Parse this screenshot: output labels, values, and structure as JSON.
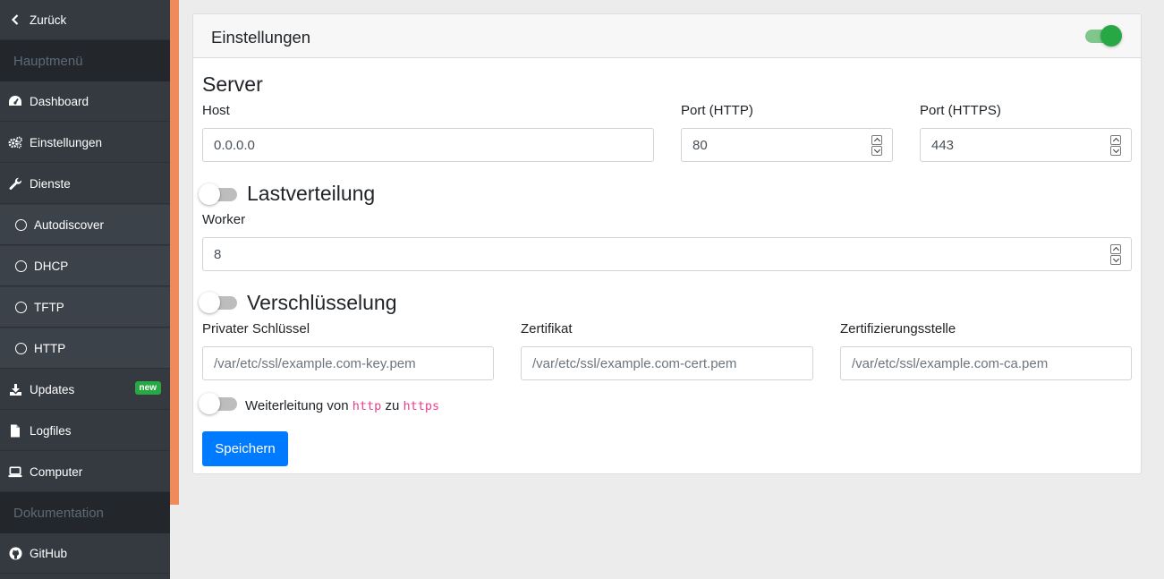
{
  "sidebar": {
    "back_label": "Zurück",
    "main_header": "Hauptmenü",
    "items": [
      {
        "label": "Dashboard",
        "icon": "dashboard-icon"
      },
      {
        "label": "Einstellungen",
        "icon": "gears-icon"
      },
      {
        "label": "Dienste",
        "icon": "wrench-icon"
      }
    ],
    "subitems": [
      {
        "label": "Autodiscover",
        "icon": "circle-icon"
      },
      {
        "label": "DHCP",
        "icon": "circle-icon"
      },
      {
        "label": "TFTP",
        "icon": "circle-icon"
      },
      {
        "label": "HTTP",
        "icon": "circle-icon"
      }
    ],
    "items2": [
      {
        "label": "Updates",
        "icon": "download-icon",
        "badge": "new"
      },
      {
        "label": "Logfiles",
        "icon": "file-icon"
      },
      {
        "label": "Computer",
        "icon": "laptop-icon"
      }
    ],
    "docs_header": "Dokumentation",
    "github_label": "GitHub"
  },
  "card": {
    "title": "Einstellungen",
    "enabled": true,
    "server": {
      "title": "Server",
      "host_label": "Host",
      "host_value": "0.0.0.0",
      "http_label": "Port (HTTP)",
      "http_value": "80",
      "https_label": "Port (HTTPS)",
      "https_value": "443"
    },
    "load": {
      "title": "Lastverteilung",
      "enabled": false,
      "worker_label": "Worker",
      "worker_value": "8"
    },
    "encryption": {
      "title": "Verschlüsselung",
      "enabled": false,
      "key_label": "Privater Schlüssel",
      "key_placeholder": "/var/etc/ssl/example.com-key.pem",
      "cert_label": "Zertifikat",
      "cert_placeholder": "/var/etc/ssl/example.com-cert.pem",
      "ca_label": "Zertifizierungsstelle",
      "ca_placeholder": "/var/etc/ssl/example.com-ca.pem"
    },
    "redirect": {
      "enabled": false,
      "text_before": "Weiterleitung von",
      "from_code": "http",
      "text_middle": "zu",
      "to_code": "https"
    },
    "save_label": "Speichern"
  },
  "colors": {
    "sidebar_bg": "#343a40",
    "accent": "#f08a5d",
    "primary": "#007bff",
    "success": "#28a745",
    "code": "#e83e8c"
  }
}
